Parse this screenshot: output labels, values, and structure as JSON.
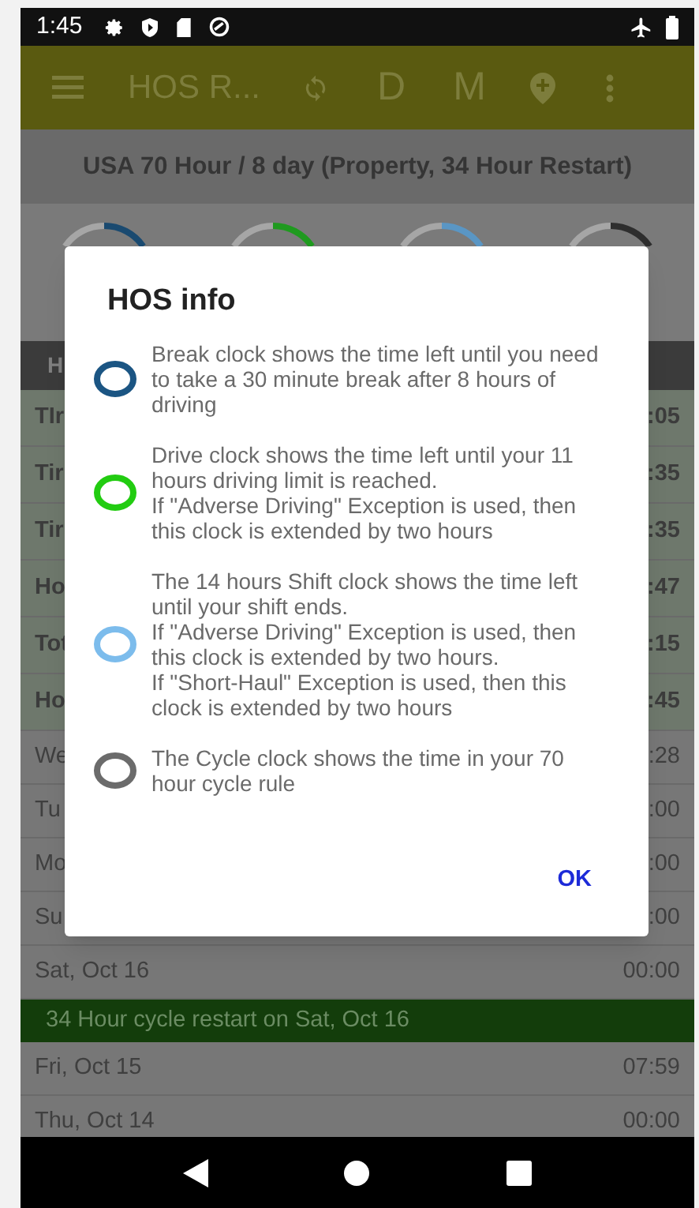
{
  "status_bar": {
    "time": "1:45"
  },
  "app_bar": {
    "title": "HOS R...",
    "actions": [
      "D",
      "M"
    ]
  },
  "ruleset": "USA 70 Hour / 8 day (Property, 34 Hour Restart)",
  "clocks": [
    {
      "color": "#1a4a70"
    },
    {
      "color": "#1f9a1f"
    },
    {
      "color": "#5a96c4"
    },
    {
      "color": "#2e2e2e"
    }
  ],
  "table_header": "H",
  "rows": [
    {
      "kind": "summary",
      "label": "TIr",
      "value": ":05"
    },
    {
      "kind": "summary",
      "label": "Tir",
      "value": ":35"
    },
    {
      "kind": "summary",
      "label": "Tir",
      "value": ":35"
    },
    {
      "kind": "summary",
      "label": "Ho",
      "value": ":47"
    },
    {
      "kind": "summary",
      "label": "Tot",
      "value": ":15"
    },
    {
      "kind": "summary",
      "label": "Ho",
      "value": ":45"
    },
    {
      "kind": "day",
      "label": "We",
      "value": ":28"
    },
    {
      "kind": "day",
      "label": "Tu",
      "value": ":00"
    },
    {
      "kind": "day",
      "label": "Mo",
      "value": ":00"
    },
    {
      "kind": "day",
      "label": "Su",
      "value": ":00"
    },
    {
      "kind": "day",
      "label": "Sat, Oct 16",
      "value": "00:00"
    },
    {
      "kind": "banner",
      "label": "34 Hour cycle restart on Sat, Oct 16"
    },
    {
      "kind": "day",
      "label": "Fri, Oct 15",
      "value": "07:59"
    },
    {
      "kind": "day",
      "label": "Thu, Oct 14",
      "value": "00:00"
    }
  ],
  "dialog": {
    "title": "HOS info",
    "items": [
      {
        "color": "#1b5583",
        "text": "Break clock shows the time left until you need to take a 30 minute break after 8 hours of driving"
      },
      {
        "color": "#22cc11",
        "text": "Drive clock shows the time left until your 11 hours driving limit is reached.\nIf \"Adverse Driving\" Exception is used, then this clock is extended by two hours"
      },
      {
        "color": "#7cbcec",
        "text": "The 14 hours Shift clock shows the time left until your shift ends.\nIf \"Adverse Driving\" Exception is used, then this clock is extended by two hours.\nIf \"Short-Haul\" Exception is used, then this clock is extended by two hours"
      },
      {
        "color": "#6b6b6b",
        "text": "The Cycle clock shows the time in your 70 hour cycle rule"
      }
    ],
    "button": "OK"
  }
}
